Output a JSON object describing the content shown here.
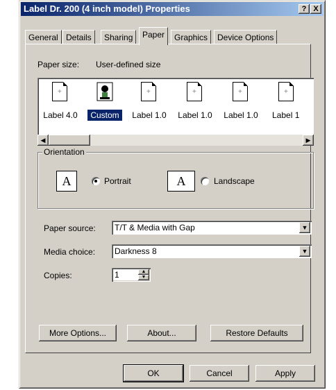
{
  "window": {
    "title": "Label Dr. 200 (4 inch model) Properties",
    "help_btn": "?",
    "close_btn": "X"
  },
  "tabs": [
    {
      "label": "General"
    },
    {
      "label": "Details"
    },
    {
      "label": "Sharing"
    },
    {
      "label": "Paper",
      "active": true
    },
    {
      "label": "Graphics"
    },
    {
      "label": "Device Options"
    }
  ],
  "paper": {
    "size_label": "Paper size:",
    "size_value": "User-defined size",
    "items": [
      {
        "label": "Label 4.0",
        "icon": "plus"
      },
      {
        "label": "Custom",
        "icon": "custom",
        "selected": true
      },
      {
        "label": "Label 1.0",
        "icon": "plus"
      },
      {
        "label": "Label 1.0",
        "icon": "plus"
      },
      {
        "label": "Label 1.0",
        "icon": "plus"
      },
      {
        "label": "Label 1",
        "icon": "plus"
      }
    ],
    "plus_glyph": "+"
  },
  "orientation": {
    "group_label": "Orientation",
    "icon_letter": "A",
    "portrait": "Portrait",
    "landscape": "Landscape",
    "selected": "portrait"
  },
  "fields": {
    "source_label": "Paper source:",
    "source_value": "T/T & Media with Gap",
    "media_label": "Media choice:",
    "media_value": "Darkness 8",
    "copies_label": "Copies:",
    "copies_value": "1"
  },
  "buttons": {
    "more_options": "More Options...",
    "about": "About...",
    "restore": "Restore Defaults",
    "ok": "OK",
    "cancel": "Cancel",
    "apply": "Apply"
  },
  "icons": {
    "dropdown": "▼",
    "left": "◀",
    "right": "▶",
    "up": "▲",
    "down": "▼"
  }
}
